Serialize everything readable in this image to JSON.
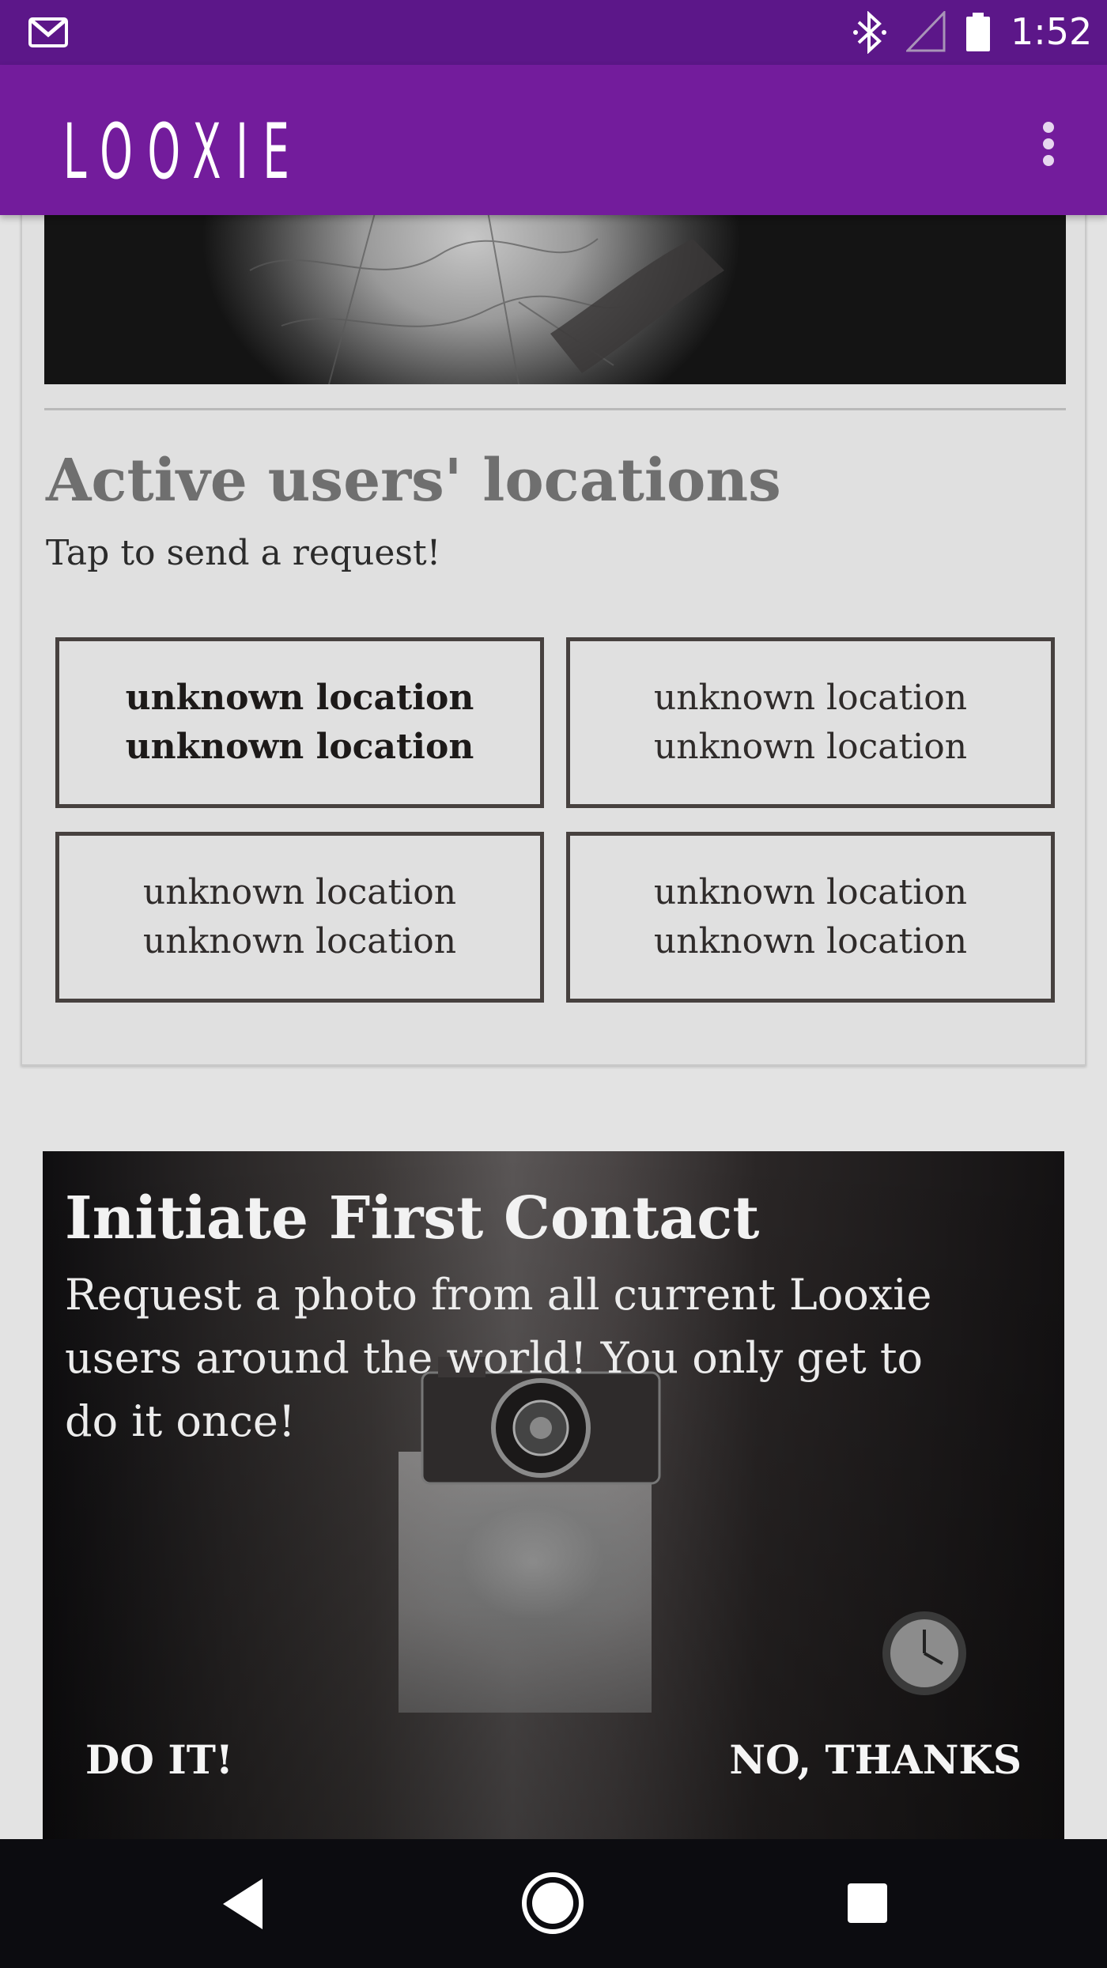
{
  "status_bar": {
    "time": "1:52",
    "icons": [
      "gmail-icon",
      "bluetooth-icon",
      "signal-icon",
      "battery-icon"
    ]
  },
  "app_bar": {
    "title": "LOOXIE",
    "menu_icon": "overflow-menu-icon",
    "color": "#731c9c"
  },
  "locations_card": {
    "image": "map-image",
    "title": "Active users' locations",
    "subtitle": "Tap to send a request!",
    "tiles": [
      {
        "line1": "unknown location",
        "line2": "unknown location",
        "bold": true
      },
      {
        "line1": "unknown location",
        "line2": "unknown location",
        "bold": false
      },
      {
        "line1": "unknown location",
        "line2": "unknown location",
        "bold": false
      },
      {
        "line1": "unknown location",
        "line2": "unknown location",
        "bold": false
      }
    ]
  },
  "contact_card": {
    "title": "Initiate First Contact",
    "body_lines": [
      "Request a photo from all current Looxie",
      "users around the world! You only get to",
      "do it once!"
    ],
    "confirm_label": "DO IT!",
    "dismiss_label": "NO, THANKS"
  },
  "nav_bar": {
    "icons": [
      "back-icon",
      "home-icon",
      "recents-icon"
    ]
  }
}
